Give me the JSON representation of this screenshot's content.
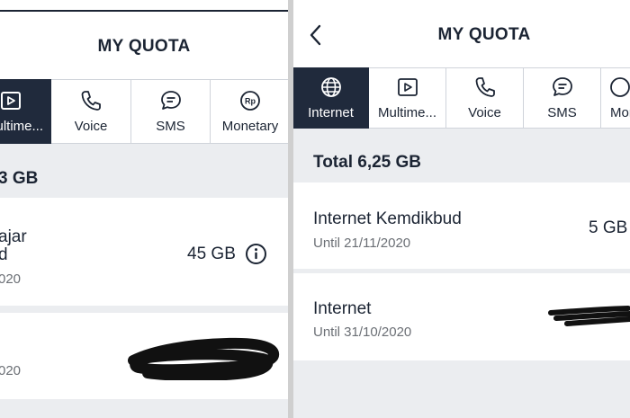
{
  "left": {
    "title": "MY QUOTA",
    "tabs": [
      {
        "label": "ultime...",
        "icon": "play-icon",
        "active": true
      },
      {
        "label": "Voice",
        "icon": "phone-icon",
        "active": false
      },
      {
        "label": "SMS",
        "icon": "chat-icon",
        "active": false
      },
      {
        "label": "Monetary",
        "icon": "rp-coin-icon",
        "active": false
      }
    ],
    "total": "3 GB",
    "items": [
      {
        "name_line1": "ajar",
        "name_line2": "d",
        "date": "020",
        "amount": "45 GB",
        "info_icon": "info-icon"
      },
      {
        "name": "",
        "date": "020",
        "amount": "redacted"
      }
    ]
  },
  "right": {
    "title": "MY QUOTA",
    "tabs": [
      {
        "label": "Internet",
        "icon": "globe-icon",
        "active": true
      },
      {
        "label": "Multime...",
        "icon": "play-icon",
        "active": false
      },
      {
        "label": "Voice",
        "icon": "phone-icon",
        "active": false
      },
      {
        "label": "SMS",
        "icon": "chat-icon",
        "active": false
      },
      {
        "label": "Mon",
        "icon": "rp-coin-icon",
        "active": false
      }
    ],
    "total": "Total 6,25 GB",
    "items": [
      {
        "name": "Internet Kemdikbud",
        "date": "Until 21/11/2020",
        "amount": "5 GB"
      },
      {
        "name": "Internet",
        "date": "Until 31/10/2020",
        "amount": "redacted"
      }
    ]
  },
  "colors": {
    "accent": "#202a3c",
    "text": "#1b2433",
    "muted": "#6b6f75",
    "band": "#ebedf0"
  }
}
